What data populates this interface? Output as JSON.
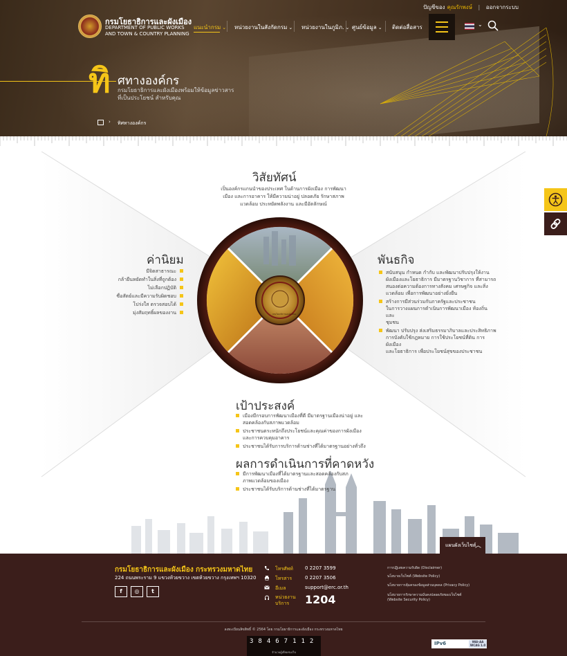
{
  "topbar": {
    "user_prefix": "ปัญชีของ",
    "user_name": "คุณรักพงษ์",
    "separator": "|",
    "logout": "ออกจากระบบ"
  },
  "org": {
    "name_th": "กรมโยธาธิการและผังเมือง",
    "name_en_1": "DEPARTMENT OF PUBLIC WORKS",
    "name_en_2": "AND TOWN & COUNTRY PLANNING"
  },
  "nav": [
    {
      "label": "แนะนำกรม",
      "has_chevron": true
    },
    {
      "label": "หน่วยงานในสังกัดกรม",
      "has_chevron": true
    },
    {
      "label": "หน่วยงานในภูมิภ.",
      "has_chevron": true
    },
    {
      "label": "ศูนย์ข้อมูล",
      "has_chevron": true
    },
    {
      "label": "ติดต่อสื่อสาร",
      "has_chevron": false
    }
  ],
  "chevron": "⌄",
  "hero": {
    "big_char": "ทิ",
    "title": "ศทางองค์กร",
    "desc_1": "กรมโยธาธิการและผังเมืองพร้อมให้ข้อมูลข่าวสาร",
    "desc_2": "ที่เป็นประโยชน์ สำหรับคุณ",
    "breadcrumb_arrow": "›",
    "breadcrumb": "ทิศทางองค์กร"
  },
  "vision": {
    "title": "วิสัยทัศน์",
    "lines": [
      "เป็นองค์กรแกนนำของประเทศ ในด้านการผังเมือง การพัฒนา",
      "เมือง และการอาคาร ให้มีความน่าอยู่ ปลอดภัย รักษาสภาพ",
      "แวดล้อม ประหยัดพลังงาน และมีอัตลักษณ์"
    ]
  },
  "values": {
    "title": "ค่านิยม",
    "items": [
      "มีจิตสาธารณะ",
      "กล้ายืนหยัดทำในสิ่งที่ถูกต้อง",
      "ไม่เลือกปฏิบัติ",
      "ซื่อสัตย์และมีความรับผิดชอบ",
      "โปร่งใส ตรวจสอบได้",
      "มุ่งสัมฤทธิ์ผลของงาน"
    ]
  },
  "mission": {
    "title": "พันธกิจ",
    "items": [
      [
        "สนับสนุน กำหนด กำกับ และพัฒนาปรับปรุงให้งาน",
        "ผังเมืองและโยธาธิการ มีมาตรฐานวิชาการ ที่สามารถ",
        "สนองต่อความต้องการทางสังคม เศรษฐกิจ และสิ่ง",
        "แวดล้อม เพื่อการพัฒนาอย่างยั่งยืน"
      ],
      [
        "สร้างการมีส่วนร่วมกับภาครัฐและประชาชน",
        "ในการวางแผนการดำเนินการพัฒนาเมือง ท้องถิ่น และ",
        "ชุมชน"
      ],
      [
        "พัฒนา ปรับปรุง ส่งเสริมธรรมาภิบาลและประสิทธิภาพ",
        "การบังคับใช้กฎหมาย การใช้ประโยชน์ที่ดิน การผังเมือง",
        "และโยธาธิการ เพื่อประโยชน์สุขของประชาชน"
      ]
    ]
  },
  "goal": {
    "title": "เป้าประสงค์",
    "items": [
      [
        "เมืองมีกรอบการพัฒนาเมืองที่ดี มีมาตรฐานเมืองน่าอยู่ และ",
        "สอดคล้องกับสภาพแวดล้อม"
      ],
      [
        "ประชาชนตระหนักถึงประโยชน์และคุณค่าของการผังเมือง",
        "และการควบคุมอาคาร"
      ],
      [
        "ประชาชนได้รับการบริการด้านช่างที่ได้มาตรฐานอย่างทั่วถึง"
      ]
    ]
  },
  "outcome": {
    "title": "ผลการดำเนินการที่คาดหวัง",
    "items": [
      [
        "มีการพัฒนาเมืองที่ได้มาตรฐานและสอดคล้องกับสภ",
        "ภาพแวดล้อมของเมือง"
      ],
      [
        "ประชาชนได้รับบริการด้านช่างที่ได้มาตรฐาน"
      ]
    ]
  },
  "seal_text": "กรมโยธาธิการและผังเมือง",
  "sitemap": {
    "label": "แผนผังเว็บไซต์",
    "arrow": "︿"
  },
  "footer": {
    "org": "กรมโยธาธิการและผังเมือง กระทรวงมหาดไทย",
    "address": "224 ถนนพระราม 9 แขวงห้วยขวาง เขตห้วยขวาง กรุงเทพฯ 10320",
    "social": [
      "f",
      "◎",
      "t"
    ],
    "phone_label": "โทรศัพท์",
    "phone": "0 2207 3599",
    "fax_label": "โทรสาร",
    "fax": "0 2207 3506",
    "email_label": "อีเมล",
    "email": "support@erc.or.th",
    "hotline_label_1": "หน่วยงาน",
    "hotline_label_2": "บริการ",
    "hotline": "1204",
    "links": [
      [
        "การปฏิเสธความรับผิด (Disclaimer)"
      ],
      [
        "นโยบายเว็บไซต์ (Website Policy)"
      ],
      [
        "นโยบายการคุ้มครองข้อมูลส่วนบุคคล (Privacy Policy)"
      ],
      [
        "นโยบายการรักษาความมั่นคงปลอดภัยของเว็บไซต์",
        "(Website Security Policy)"
      ]
    ],
    "copyright": "ลงทะเบียนลิขสิทธิ์ © 2564 โดย กรมโยธาธิการและผังเมือง กระทรวงมหาดไทย",
    "counter": "38467112",
    "counter_label": "จำนวนผู้เยี่ยมชมเว็บ",
    "badge_ipv6": "IPv6",
    "badge_wcag": "WAI-AA WCAG 1.0"
  },
  "colors": {
    "brand_dark": "#3b1e1b",
    "accent": "#f5c518"
  },
  "icons": {
    "search": "search-icon",
    "menu": "hamburger-menu-icon",
    "home": "home-icon",
    "accessibility": "accessibility-icon",
    "link": "link-icon",
    "phone": "phone-icon",
    "fax": "printer-icon",
    "email": "mail-icon",
    "hotline": "headset-icon"
  }
}
